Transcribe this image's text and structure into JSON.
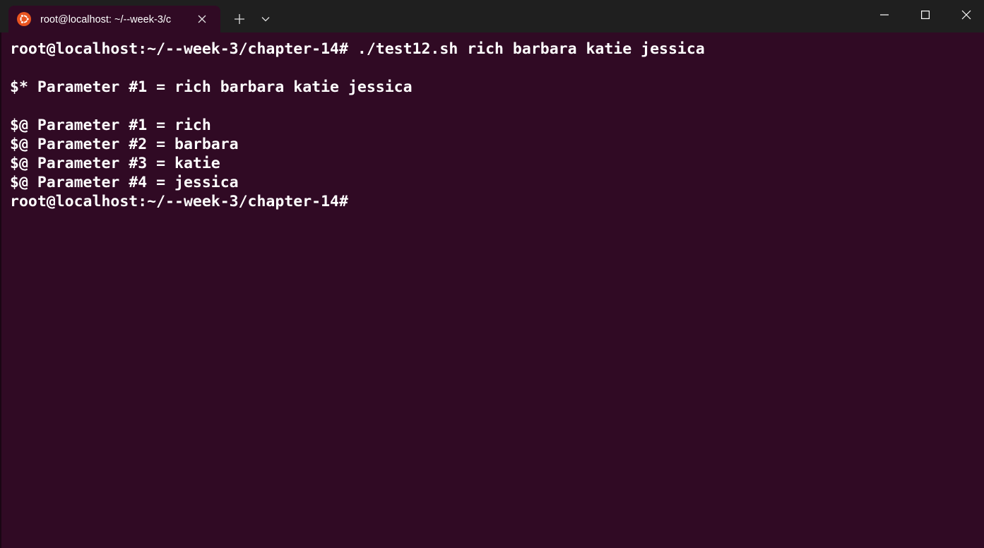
{
  "window": {
    "tab_title": "root@localhost: ~/--week-3/c",
    "tab_icon": "ubuntu-logo-icon",
    "new_tab_icon": "plus-icon",
    "dropdown_icon": "chevron-down-icon",
    "minimize_icon": "minimize-icon",
    "maximize_icon": "maximize-icon",
    "close_icon": "close-icon"
  },
  "colors": {
    "terminal_bg": "#300a24",
    "titlebar_bg": "#1f1f1f",
    "text": "#ffffff",
    "ubuntu_orange": "#e95420"
  },
  "terminal": {
    "lines": [
      "root@localhost:~/--week-3/chapter-14# ./test12.sh rich barbara katie jessica",
      "",
      "$* Parameter #1 = rich barbara katie jessica",
      "",
      "$@ Parameter #1 = rich",
      "$@ Parameter #2 = barbara",
      "$@ Parameter #3 = katie",
      "$@ Parameter #4 = jessica",
      "root@localhost:~/--week-3/chapter-14#"
    ]
  }
}
